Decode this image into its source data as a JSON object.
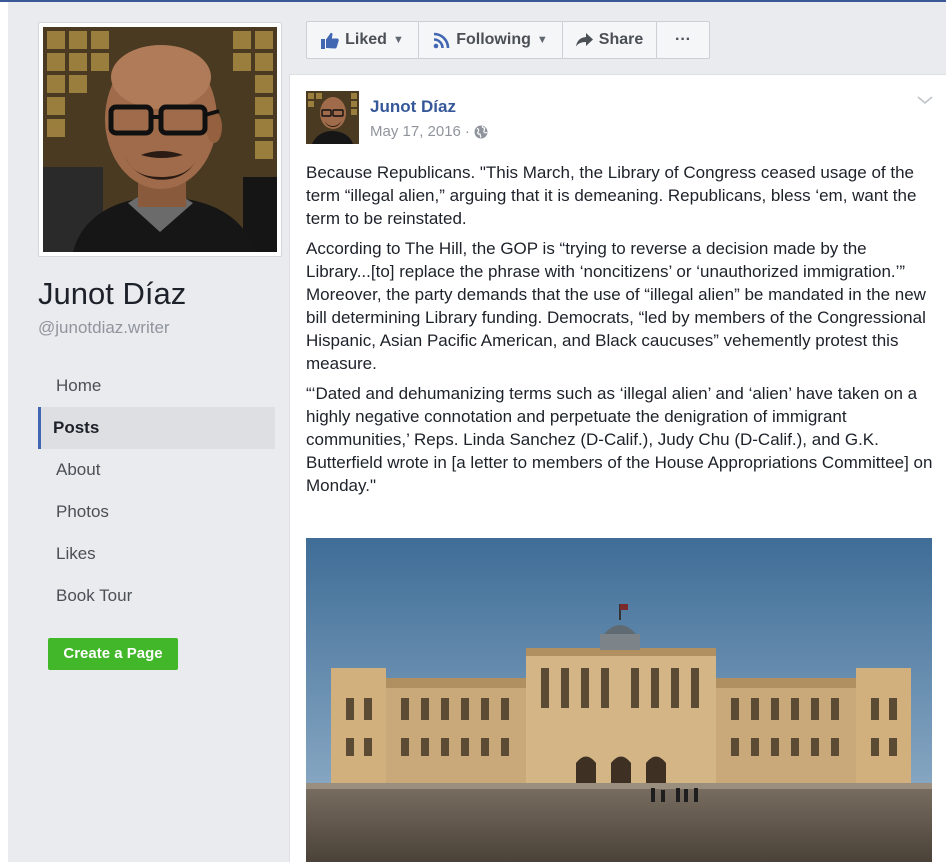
{
  "page": {
    "name": "Junot Díaz",
    "handle": "@junotdiaz.writer"
  },
  "nav": {
    "items": [
      {
        "label": "Home",
        "active": false
      },
      {
        "label": "Posts",
        "active": true
      },
      {
        "label": "About",
        "active": false
      },
      {
        "label": "Photos",
        "active": false
      },
      {
        "label": "Likes",
        "active": false
      },
      {
        "label": "Book Tour",
        "active": false
      }
    ],
    "create_page_label": "Create a Page"
  },
  "action_bar": {
    "liked_label": "Liked",
    "following_label": "Following",
    "share_label": "Share",
    "more_label": "···"
  },
  "post": {
    "author": "Junot Díaz",
    "date": "May 17, 2016",
    "separator": "·",
    "paragraphs": [
      "Because Republicans. \"This March, the Library of Congress ceased usage of the term “illegal alien,” arguing that it is demeaning. Republicans, bless ‘em, want the term to be reinstated.",
      "According to The Hill, the GOP is “trying to reverse a decision made by the Library...[to] replace the phrase with ‘noncitizens’ or ‘unauthorized immigration.’” Moreover, the party demands that the use of “illegal alien” be mandated in the new bill determining Library funding. Democrats, “led by members of the Congressional Hispanic, Asian Pacific American, and Black caucuses” vehemently protest this measure.",
      "“‘Dated and dehumanizing terms such as ‘illegal alien’ and ‘alien’ have taken on a highly negative connotation and perpetuate the denigration of immigrant communities,’ Reps. Linda Sanchez (D-Calif.), Judy Chu (D-Calif.), and G.K. Butterfield wrote in [a letter to members of the House Appropriations Committee] on Monday.\""
    ]
  },
  "colors": {
    "link_blue": "#365899",
    "accent_blue": "#4267b2",
    "create_green": "#42b72a",
    "background": "#e9ebee"
  },
  "icons": {
    "liked": "thumbs-up-icon",
    "following": "rss-icon",
    "share": "share-arrow-icon",
    "privacy": "globe-icon",
    "post_menu": "chevron-down-icon"
  }
}
